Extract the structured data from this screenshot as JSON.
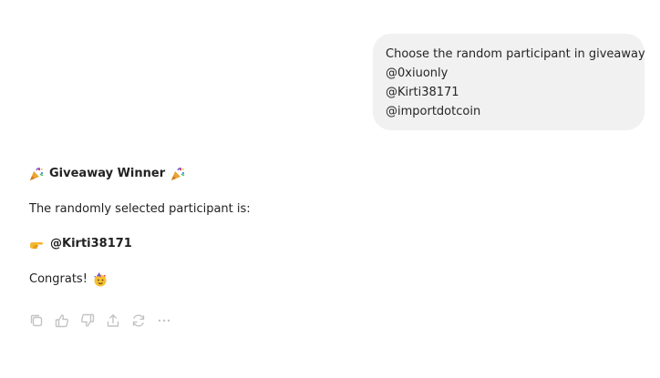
{
  "user_message": {
    "lines": [
      "Choose the random participant in giveaway",
      "@0xiuonly",
      "@Kirti38171",
      "@importdotcoin"
    ]
  },
  "assistant_reply": {
    "title": "Giveaway Winner",
    "title_icon": "party-popper-icon",
    "intro": "The randomly selected participant is:",
    "winner_icon": "pointing-right-icon",
    "winner": "@Kirti38171",
    "congrats": "Congrats!",
    "congrats_icon": "partying-face-icon"
  },
  "actions": [
    {
      "icon": "copy-icon"
    },
    {
      "icon": "thumbs-up-icon"
    },
    {
      "icon": "thumbs-down-icon"
    },
    {
      "icon": "share-icon"
    },
    {
      "icon": "regenerate-icon"
    },
    {
      "icon": "more-icon"
    }
  ],
  "colors": {
    "bubble_background": "#f1f1f1",
    "text": "#222222",
    "action_icon": "#c4c4c4"
  }
}
